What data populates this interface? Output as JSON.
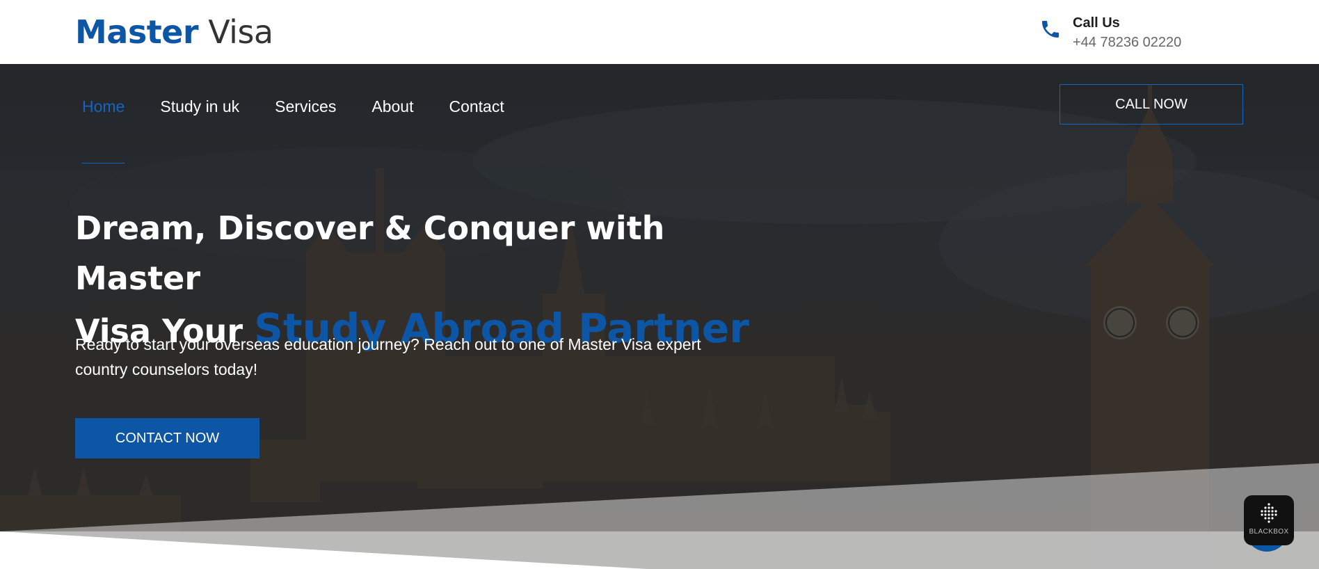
{
  "header": {
    "logo_part1": "Master",
    "logo_part2": "Visa",
    "call_title": "Call Us",
    "call_number": "+44 78236 02220"
  },
  "nav": {
    "items": [
      {
        "label": "Home",
        "active": true
      },
      {
        "label": "Study in uk",
        "active": false
      },
      {
        "label": "Services",
        "active": false
      },
      {
        "label": "About",
        "active": false
      },
      {
        "label": "Contact",
        "active": false
      }
    ],
    "cta_label": "CALL NOW"
  },
  "hero": {
    "headline_line1": "Dream, Discover & Conquer with Master",
    "headline_line2": "Visa Your",
    "headline_accent": "Study Abroad Partner",
    "subtext": "Ready to start your overseas education journey? Reach out to one of Master Visa expert country counselors today!",
    "cta_label": "CONTACT NOW"
  },
  "widgets": {
    "blackbox_label": "BLACKBOX"
  },
  "icons": {
    "call": "phone-icon",
    "fab": "phone-icon",
    "blackbox": "blackbox-logo-icon"
  },
  "colors": {
    "brand": "#0d56a6",
    "accent_nav": "#1565c0",
    "hero_bg": "#2f3236"
  }
}
